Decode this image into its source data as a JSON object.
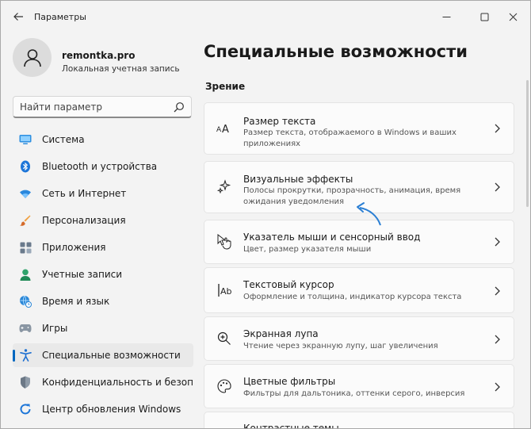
{
  "window": {
    "title": "Параметры"
  },
  "profile": {
    "name": "remontka.pro",
    "account_type": "Локальная учетная запись"
  },
  "search": {
    "placeholder": "Найти параметр"
  },
  "sidebar": {
    "items": [
      {
        "label": "Система",
        "icon": "monitor-icon"
      },
      {
        "label": "Bluetooth и устройства",
        "icon": "bluetooth-icon"
      },
      {
        "label": "Сеть и Интернет",
        "icon": "wifi-icon"
      },
      {
        "label": "Персонализация",
        "icon": "brush-icon"
      },
      {
        "label": "Приложения",
        "icon": "apps-icon"
      },
      {
        "label": "Учетные записи",
        "icon": "user-icon"
      },
      {
        "label": "Время и язык",
        "icon": "globe-clock-icon"
      },
      {
        "label": "Игры",
        "icon": "gamepad-icon"
      },
      {
        "label": "Специальные возможности",
        "icon": "accessibility-icon",
        "active": true
      },
      {
        "label": "Конфиденциальность и безопас",
        "icon": "shield-icon"
      },
      {
        "label": "Центр обновления Windows",
        "icon": "update-icon"
      }
    ]
  },
  "main": {
    "title": "Специальные возможности",
    "section": "Зрение",
    "cards": [
      {
        "title": "Размер текста",
        "desc": "Размер текста, отображаемого в Windows и ваших приложениях",
        "icon": "text-size-icon"
      },
      {
        "title": "Визуальные эффекты",
        "desc": "Полосы прокрутки, прозрачность, анимация, время ожидания уведомления",
        "icon": "sparkle-icon"
      },
      {
        "title": "Указатель мыши и сенсорный ввод",
        "desc": "Цвет, размер указателя мыши",
        "icon": "pointer-hand-icon"
      },
      {
        "title": "Текстовый курсор",
        "desc": "Оформление и толщина, индикатор курсора текста",
        "icon": "text-cursor-icon"
      },
      {
        "title": "Экранная лупа",
        "desc": "Чтение через экранную лупу, шаг увеличения",
        "icon": "magnifier-icon"
      },
      {
        "title": "Цветные фильтры",
        "desc": "Фильтры для дальтоника, оттенки серого, инверсия",
        "icon": "palette-icon"
      },
      {
        "title": "Контрастные темы",
        "desc": "",
        "icon": "contrast-icon"
      }
    ]
  },
  "colors": {
    "accent": "#0067c0",
    "annotation_arrow": "#2b7fd4"
  }
}
